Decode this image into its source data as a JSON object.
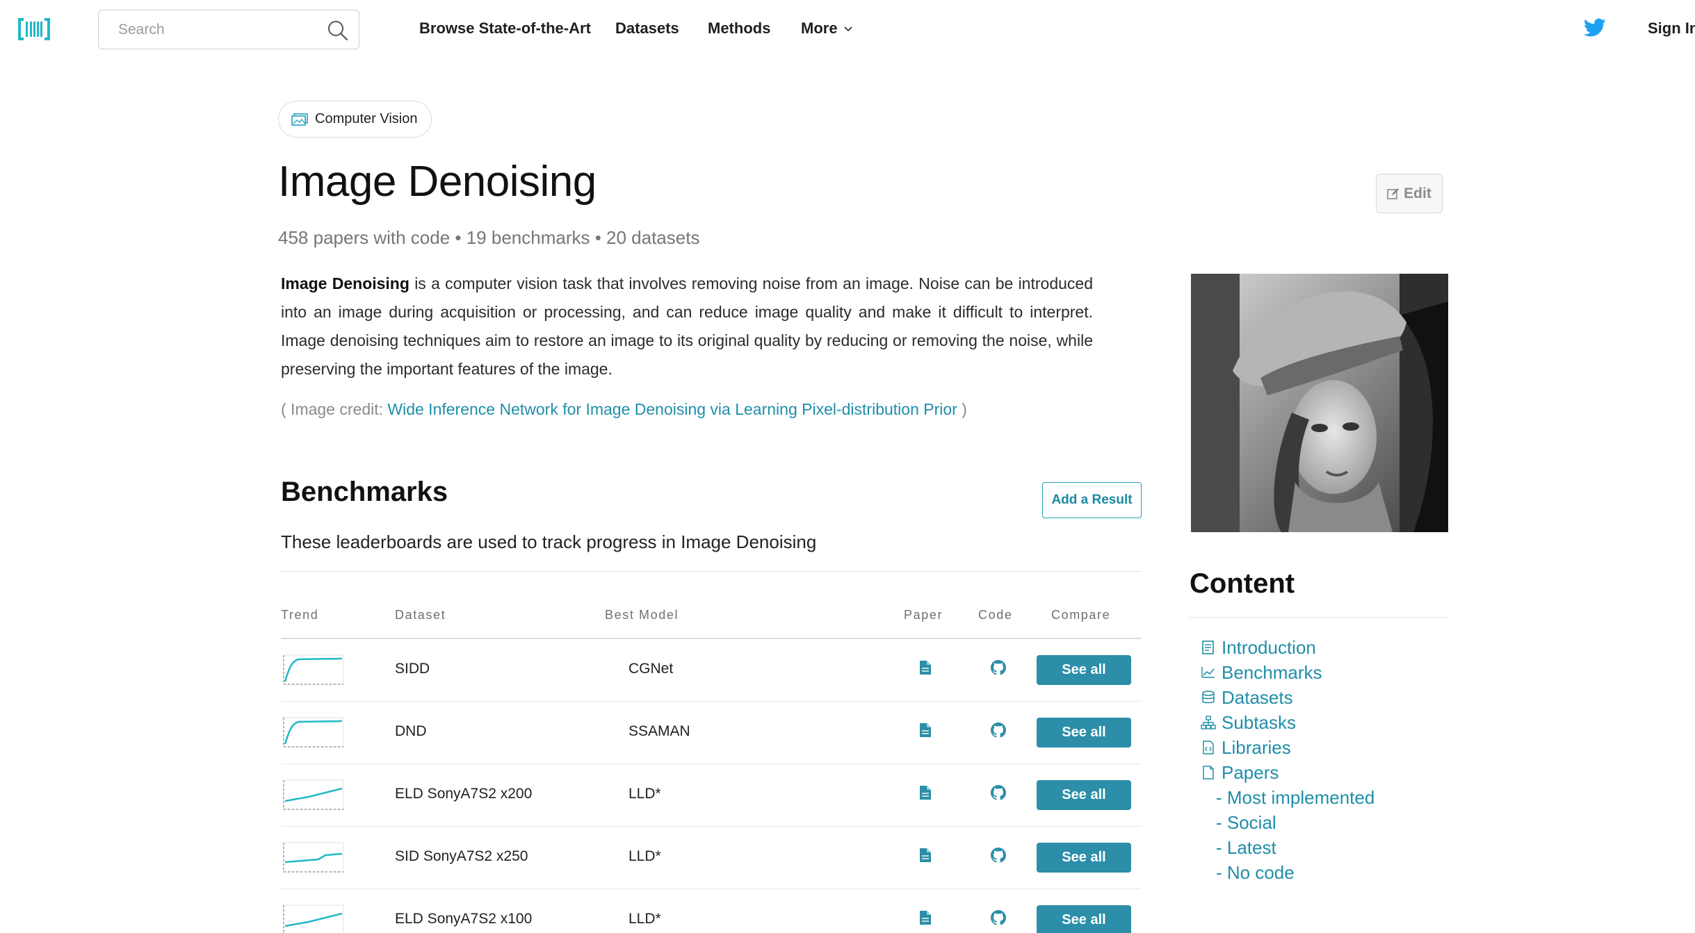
{
  "nav": {
    "search_placeholder": "Search",
    "links": [
      "Browse State-of-the-Art",
      "Datasets",
      "Methods",
      "More"
    ],
    "sign_in": "Sign In"
  },
  "area": {
    "label": "Computer Vision"
  },
  "task": {
    "title": "Image Denoising",
    "edit_label": "Edit",
    "stats": "458 papers with code • 19 benchmarks • 20 datasets",
    "description_bold": "Image Denoising",
    "description_rest": " is a computer vision task that involves removing noise from an image. Noise can be introduced into an image during acquisition or processing, and can reduce image quality and make it difficult to interpret. Image denoising techniques aim to restore an image to its original quality by reducing or removing the noise, while preserving the important features of the image.",
    "credit_prefix": "( Image credit: ",
    "credit_link": "Wide Inference Network for Image Denoising via Learning Pixel-distribution Prior",
    "credit_suffix": " )"
  },
  "benchmarks": {
    "heading": "Benchmarks",
    "add_result": "Add a Result",
    "subtitle": "These leaderboards are used to track progress in Image Denoising",
    "columns": [
      "Trend",
      "Dataset",
      "Best Model",
      "Paper",
      "Code",
      "Compare"
    ],
    "see_all": "See all",
    "rows": [
      {
        "dataset": "SIDD",
        "model": "CGNet",
        "trend": "plateau"
      },
      {
        "dataset": "DND",
        "model": "SSAMAN",
        "trend": "plateau"
      },
      {
        "dataset": "ELD SonyA7S2 x200",
        "model": "LLD*",
        "trend": "rising"
      },
      {
        "dataset": "SID SonyA7S2 x250",
        "model": "LLD*",
        "trend": "step"
      },
      {
        "dataset": "ELD SonyA7S2 x100",
        "model": "LLD*",
        "trend": "rising"
      }
    ]
  },
  "content": {
    "heading": "Content",
    "items": [
      "Introduction",
      "Benchmarks",
      "Datasets",
      "Subtasks",
      "Libraries",
      "Papers"
    ],
    "sub_items": [
      "- Most implemented",
      "- Social",
      "- Latest",
      "- No code"
    ]
  },
  "colors": {
    "accent": "#21a0b8",
    "button": "#2c8ea8",
    "link": "#1f8ea8",
    "twitter": "#1da1f2"
  }
}
